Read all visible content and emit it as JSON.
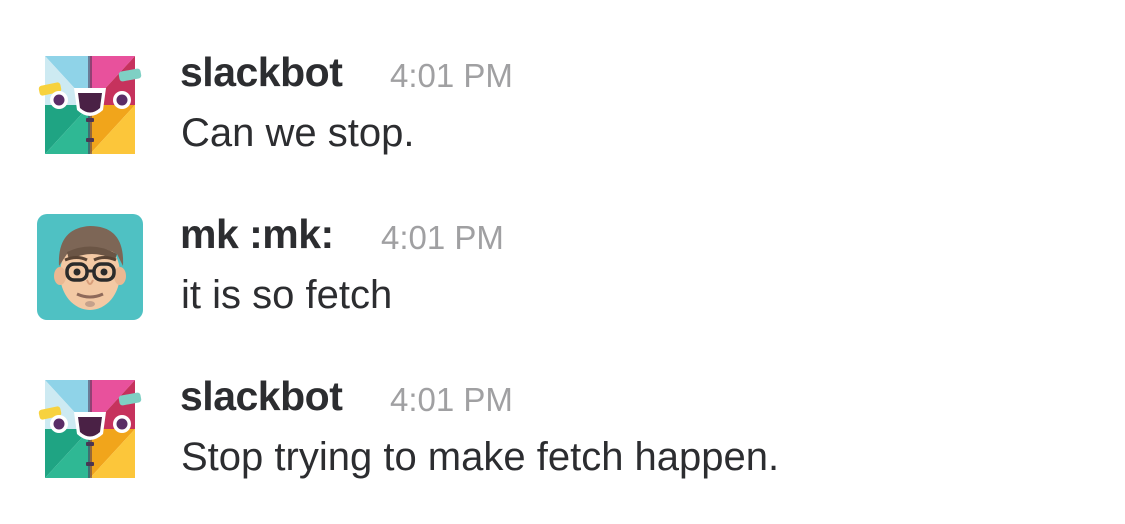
{
  "messages": [
    {
      "author": "slackbot",
      "time": "4:01 PM",
      "text": "Can we stop.",
      "avatar": "slackbot-avatar"
    },
    {
      "author": "mk :mk:",
      "time": "4:01 PM",
      "text": "it is so fetch",
      "avatar": "cartoon-face-avatar"
    },
    {
      "author": "slackbot",
      "time": "4:01 PM",
      "text": "Stop trying to make fetch happen.",
      "avatar": "slackbot-avatar"
    }
  ],
  "colors": {
    "author_text": "#2c2d30",
    "timestamp_text": "#a0a0a2",
    "message_text": "#2c2d30",
    "mk_avatar_bg": "#4fc1c3"
  }
}
